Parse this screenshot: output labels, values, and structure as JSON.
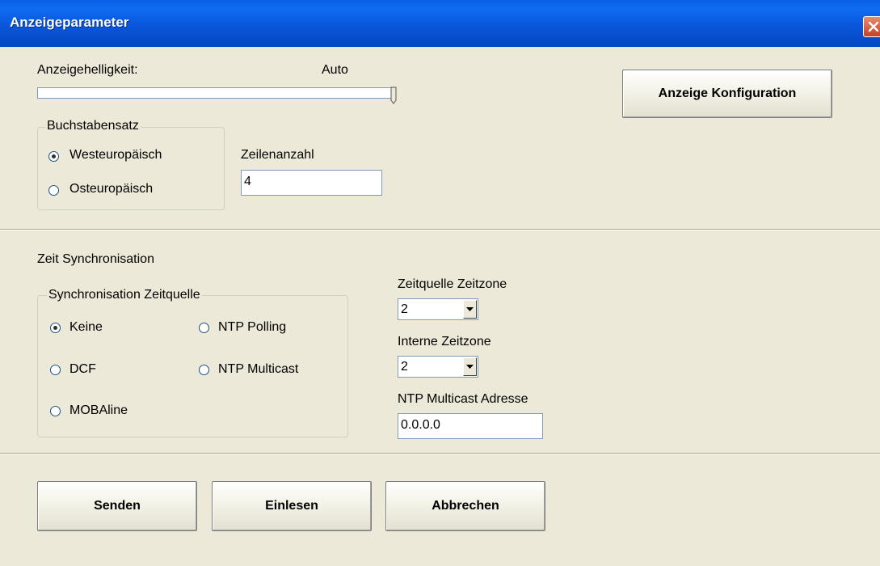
{
  "window": {
    "title": "Anzeigeparameter"
  },
  "brightness": {
    "label": "Anzeigehelligkeit:",
    "value_text": "Auto",
    "level": 1.0
  },
  "config_button": "Anzeige Konfiguration",
  "charset": {
    "legend": "Buchstabensatz",
    "options": [
      "Westeuropäisch",
      "Osteuropäisch"
    ],
    "selected": "Westeuropäisch"
  },
  "lines": {
    "label": "Zeilenanzahl",
    "value": "4"
  },
  "time_sync": {
    "heading": "Zeit Synchronisation",
    "source_group": {
      "legend": "Synchronisation Zeitquelle",
      "options": [
        "Keine",
        "NTP Polling",
        "DCF",
        "NTP Multicast",
        "MOBAline"
      ],
      "selected": "Keine"
    },
    "source_timezone": {
      "label": "Zeitquelle Zeitzone",
      "value": "2"
    },
    "internal_timezone": {
      "label": "Interne Zeitzone",
      "value": "2"
    },
    "ntp_multicast": {
      "label": "NTP Multicast Adresse",
      "value": "0.0.0.0"
    }
  },
  "buttons": {
    "send": "Senden",
    "read": "Einlesen",
    "cancel": "Abbrechen"
  },
  "colors": {
    "title_bar": "#0a56da",
    "background": "#ece9d8",
    "close": "#c8402a"
  }
}
